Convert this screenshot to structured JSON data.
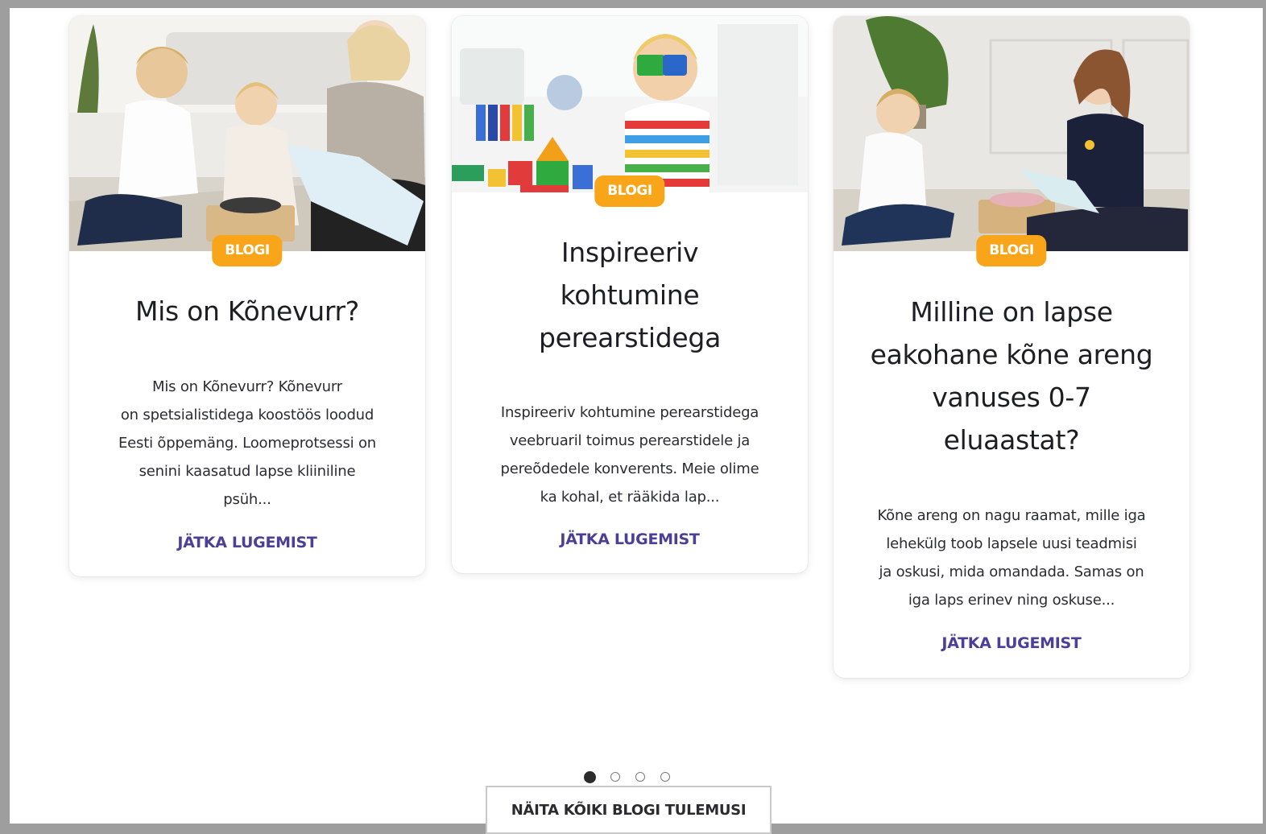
{
  "cards": [
    {
      "badge": "BLOGI",
      "title_lines": [
        "Mis on Kõnevurr?"
      ],
      "excerpt_lines": [
        "Mis on Kõnevurr? Kõnevurr",
        "on spetsialistidega koostöös loodud",
        "Eesti õppemäng. Loomeprotsessi on",
        "senini kaasatud lapse kliiniline",
        "psüh..."
      ],
      "link": "JÄTKA LUGEMIST",
      "image_icon": "photo-children-playing-board-game"
    },
    {
      "badge": "BLOGI",
      "title_lines": [
        "Inspireeriv",
        "kohtumine",
        "perearstidega"
      ],
      "excerpt_lines": [
        "Inspireeriv kohtumine perearstidega",
        "veebruaril toimus perearstidele ja",
        "pereõdedele konverents. Meie olime",
        "ka kohal, et rääkida lap..."
      ],
      "link": "JÄTKA LUGEMIST",
      "image_icon": "photo-child-with-toy-blocks"
    },
    {
      "badge": "BLOGI",
      "title_lines": [
        "Milline on lapse",
        "eakohane kõne areng",
        "vanuses 0-7",
        "eluaastat?"
      ],
      "excerpt_lines": [
        "Kõne areng on nagu raamat, mille iga",
        "lehekülg toob lapsele uusi teadmisi",
        "ja oskusi, mida omandada. Samas on",
        "iga laps erinev ning oskuse..."
      ],
      "link": "JÄTKA LUGEMIST",
      "image_icon": "photo-boy-and-therapist-on-floor"
    }
  ],
  "carousel": {
    "page_count": 4,
    "active_index": 0
  },
  "show_all_button": "NÄITA KÕIKI BLOGI TULEMUSI",
  "colors": {
    "badge": "#f9a51a",
    "link": "#4a3f99",
    "title": "#1d1d24"
  }
}
